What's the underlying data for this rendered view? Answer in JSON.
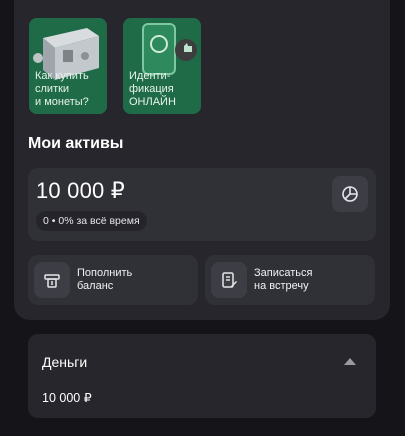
{
  "stories": [
    {
      "label": "Как купить\nслитки\nи монеты?",
      "icon": "safe-with-coins"
    },
    {
      "label": "Иденти-\nфикация\nОНЛАЙН",
      "icon": "phone-thumbs-up"
    }
  ],
  "assets": {
    "title": "Мои активы",
    "balance": "10 000 ₽",
    "change": "0 • 0% за всё время",
    "chart_icon": "pie-chart-icon"
  },
  "actions": [
    {
      "label": "Пополнить\nбаланс",
      "icon": "deposit-icon"
    },
    {
      "label": "Записаться\nна встречу",
      "icon": "document-edit-icon"
    }
  ],
  "money": {
    "title": "Деньги",
    "value": "10 000 ₽",
    "toggle_icon": "caret-up-icon"
  },
  "colors": {
    "background": "#151519",
    "card": "#26262c",
    "inner_card": "#303037",
    "story_green": "#1f6b47"
  }
}
